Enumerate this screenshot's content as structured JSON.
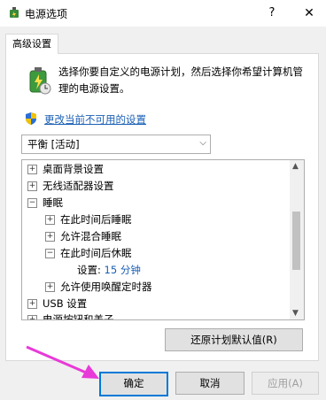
{
  "window": {
    "title": "电源选项",
    "help_label": "?",
    "close_label": "✕"
  },
  "tab": {
    "label": "高级设置"
  },
  "description": "选择你要自定义的电源计划，然后选择你希望计算机管理的电源设置。",
  "link_text": "更改当前不可用的设置",
  "plan_select": {
    "value": "平衡 [活动]"
  },
  "tree": {
    "rows": [
      {
        "toggle": "⊞",
        "label": "桌面背景设置"
      },
      {
        "toggle": "⊞",
        "label": "无线适配器设置"
      },
      {
        "toggle": "⊟",
        "label": "睡眠"
      },
      {
        "toggle": "⊞",
        "label": "在此时间后睡眠"
      },
      {
        "toggle": "⊞",
        "label": "允许混合睡眠"
      },
      {
        "toggle": "⊟",
        "label": "在此时间后休眠"
      },
      {
        "toggle": "",
        "label": "设置:",
        "value": "15 分钟"
      },
      {
        "toggle": "⊞",
        "label": "允许使用唤醒定时器"
      },
      {
        "toggle": "⊞",
        "label": "USB 设置"
      },
      {
        "toggle": "⊞",
        "label": "电源按钮和盖子"
      }
    ]
  },
  "buttons": {
    "restore": "还原计划默认值(R)",
    "ok": "确定",
    "cancel": "取消",
    "apply": "应用(A)"
  },
  "colors": {
    "accent": "#0078d7",
    "link": "#1a5fb4",
    "arrow": "#e83ad8"
  }
}
